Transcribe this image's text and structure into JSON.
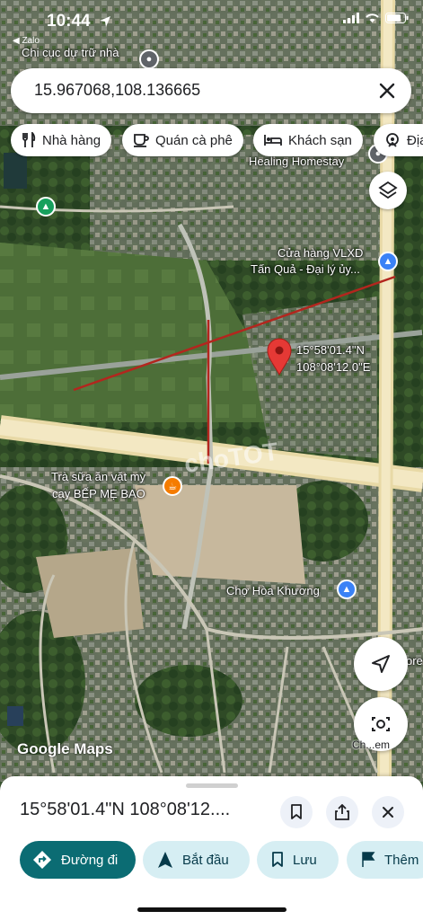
{
  "status": {
    "time": "10:44",
    "back_app": "◀ Zalo"
  },
  "search": {
    "value": "15.967068,108.136665"
  },
  "chips": [
    {
      "label": "Nhà hàng",
      "icon": "restaurant-icon"
    },
    {
      "label": "Quán cà phê",
      "icon": "coffee-icon"
    },
    {
      "label": "Khách sạn",
      "icon": "hotel-icon"
    },
    {
      "label": "Địa",
      "icon": "attraction-icon"
    }
  ],
  "map": {
    "labels": {
      "chi_cuc": "Chi cục dự trữ nhà",
      "homestay": "Healing Homestay",
      "vlxd_line1": "Cửa hàng VLXD",
      "vlxd_line2": "Tấn Quả - Đại lý ủy...",
      "pin_lat": "15°58'01.4\"N",
      "pin_lng": "108°08'12.0\"E",
      "tra_sua_line1": "Trà sữa ăn vặt mỳ",
      "tra_sua_line2": "cay BẾP MẸ BAO",
      "cho": "Chợ Hòa Khương",
      "edge_label": "ore",
      "watermark": "choTOT"
    },
    "camera_label": "Ch...em",
    "logo": "Google Maps"
  },
  "sheet": {
    "title": "15°58'01.4\"N 108°08'12....",
    "actions": {
      "directions": "Đường đi",
      "start": "Bắt đầu",
      "save": "Lưu",
      "more": "Thêm"
    }
  },
  "colors": {
    "primary": "#0b6c73",
    "secondary": "#d6eef3",
    "pin": "#e53935",
    "drawn_line": "#b3261e"
  }
}
